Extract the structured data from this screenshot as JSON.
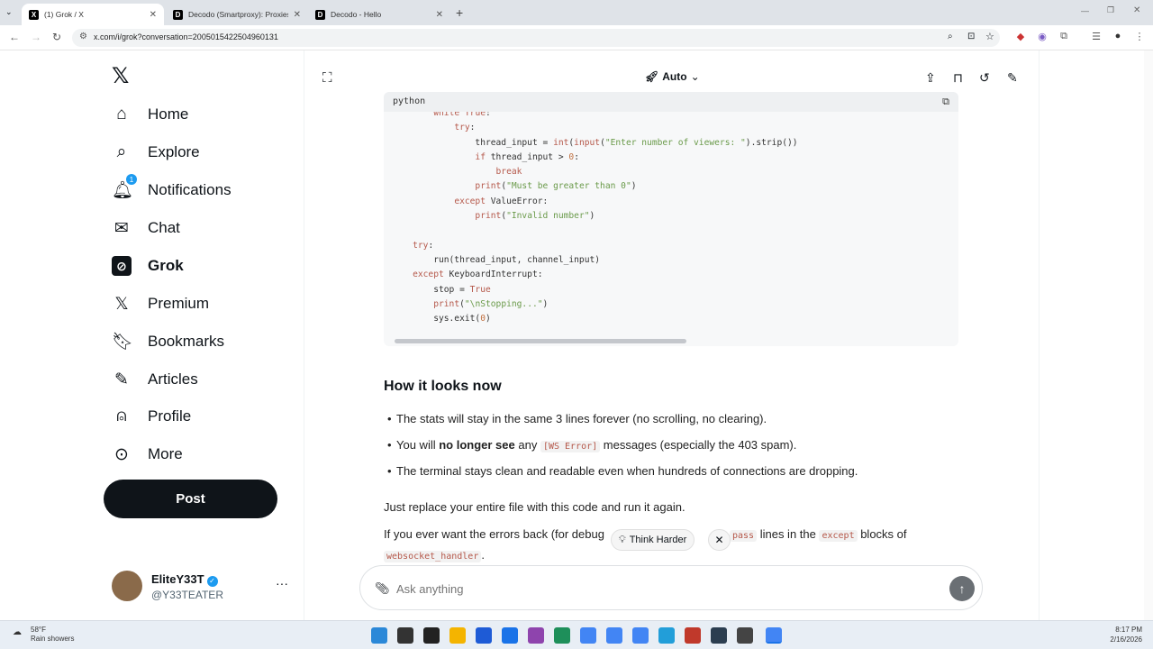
{
  "browser": {
    "tabs": [
      {
        "label": "(1) Grok / X",
        "active": true
      },
      {
        "label": "Decodo (Smartproxy): Proxies &",
        "active": false
      },
      {
        "label": "Decodo - Hello",
        "active": false
      }
    ],
    "url": "x.com/i/grok?conversation=2005015422504960131"
  },
  "sidebar": {
    "items": [
      {
        "label": "Home",
        "icon": "home-icon"
      },
      {
        "label": "Explore",
        "icon": "search-icon"
      },
      {
        "label": "Notifications",
        "icon": "bell-icon",
        "badge": "1"
      },
      {
        "label": "Chat",
        "icon": "mail-icon"
      },
      {
        "label": "Grok",
        "icon": "grok-icon",
        "active": true
      },
      {
        "label": "Premium",
        "icon": "x-icon"
      },
      {
        "label": "Bookmarks",
        "icon": "bookmark-icon"
      },
      {
        "label": "Articles",
        "icon": "articles-icon"
      },
      {
        "label": "Profile",
        "icon": "person-icon"
      },
      {
        "label": "More",
        "icon": "more-circle-icon"
      }
    ],
    "post_label": "Post",
    "profile": {
      "name": "EliteY33T",
      "handle": "@Y33TEATER"
    }
  },
  "topbar": {
    "mode": "Auto"
  },
  "code": {
    "lang": "python"
  },
  "content": {
    "heading": "How it looks now",
    "bullet1": "The stats will stay in the same 3 lines forever (no scrolling, no clearing).",
    "bullet2_pre": "You will ",
    "bullet2_bold": "no longer see",
    "bullet2_mid": " any ",
    "bullet2_code": "[WS Error]",
    "bullet2_post": " messages (especially the 403 spam).",
    "bullet3": "The terminal stays clean and readable even when hundreds of connections are dropping.",
    "para1": "Just replace your entire file with this code and run it again.",
    "para2_pre": "If you ever want the errors back (for debug",
    "para2_code1": "pass",
    "para2_mid": " lines in the ",
    "para2_code2": "except",
    "para2_post": " blocks of",
    "para2_code3": "websocket_handler",
    "para2_end": "."
  },
  "chips": {
    "think_harder": "Think Harder"
  },
  "input": {
    "placeholder": "Ask anything"
  },
  "taskbar": {
    "weather_temp": "58°F",
    "weather_desc": "Rain showers",
    "time": "8:17 PM",
    "date": "2/16/2026"
  }
}
